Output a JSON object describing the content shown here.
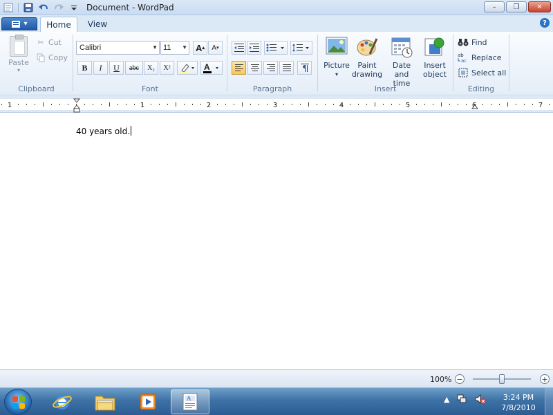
{
  "window": {
    "title": "Document - WordPad",
    "minimize_glyph": "–",
    "maximize_glyph": "❐",
    "close_glyph": "✕"
  },
  "ribbon_tabs": {
    "home": "Home",
    "view": "View",
    "help_glyph": "?"
  },
  "clipboard": {
    "paste": "Paste",
    "cut": "Cut",
    "copy": "Copy",
    "label": "Clipboard"
  },
  "font": {
    "family": "Calibri",
    "size": "11",
    "label": "Font",
    "bold": "B",
    "italic": "I",
    "underline": "U",
    "strikethrough": "abc",
    "subscript": "X₂",
    "superscript": "X²",
    "grow": "A",
    "shrink": "A"
  },
  "paragraph": {
    "label": "Paragraph"
  },
  "insert": {
    "picture": "Picture",
    "paint_line1": "Paint",
    "paint_line2": "drawing",
    "datetime_line1": "Date and",
    "datetime_line2": "time",
    "object_line1": "Insert",
    "object_line2": "object",
    "label": "Insert"
  },
  "editing": {
    "find": "Find",
    "replace": "Replace",
    "select_all": "Select all",
    "label": "Editing"
  },
  "ruler": {
    "numbers": [
      "1",
      "1",
      "2",
      "3",
      "4",
      "5",
      "6",
      "7"
    ]
  },
  "document": {
    "text": "40 years old."
  },
  "status": {
    "zoom": "100%",
    "zoom_fraction": 0.5,
    "zoom_out": "−",
    "zoom_in": "+"
  },
  "taskbar": {
    "time": "3:24 PM",
    "date": "7/8/2010"
  },
  "colors": {
    "accent": "#2b72c9",
    "ribbon": "#dbe8f6",
    "active_button": "#f7c95c",
    "close_button": "#c7412c"
  }
}
